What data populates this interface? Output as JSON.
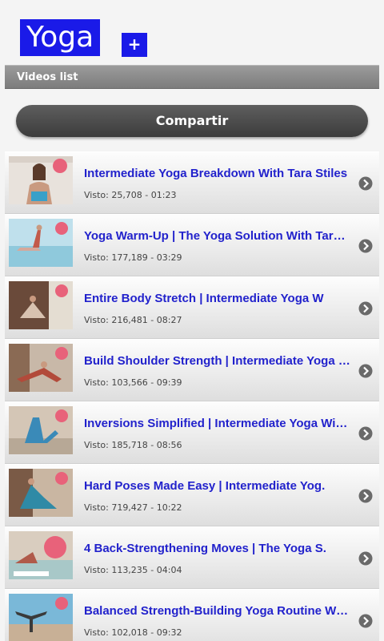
{
  "header": {
    "title": "Yoga",
    "add_label": "+"
  },
  "section": {
    "label": "Videos list"
  },
  "share": {
    "label": "Compartir"
  },
  "videos": [
    {
      "title": "Intermediate Yoga Breakdown With Tara Stiles",
      "meta": "Visto: 25,708 - 01:23"
    },
    {
      "title": "Yoga Warm-Up | The Yoga Solution With Tara Stiles",
      "meta": "Visto: 177,189 - 03:29"
    },
    {
      "title": "Entire Body Stretch | Intermediate Yoga W",
      "meta": "Visto: 216,481 - 08:27"
    },
    {
      "title": "Build Shoulder Strength | Intermediate Yoga With Tara",
      "meta": "Visto: 103,566 - 09:39"
    },
    {
      "title": "Inversions Simplified | Intermediate Yoga With Tara",
      "meta": "Visto: 185,718 - 08:56"
    },
    {
      "title": "Hard Poses Made Easy | Intermediate Yog.",
      "meta": "Visto: 719,427 - 10:22"
    },
    {
      "title": "4 Back-Strengthening Moves | The Yoga S.",
      "meta": "Visto: 113,235 - 04:04"
    },
    {
      "title": "Balanced Strength-Building Yoga Routine With Tara",
      "meta": "Visto: 102,018 - 09:32"
    }
  ],
  "colors": {
    "accent": "#1a1ae8",
    "link": "#2222cc",
    "arrow": "#6a6a6a"
  },
  "icons": {
    "row_arrow": "chevron-right-circle-icon"
  }
}
